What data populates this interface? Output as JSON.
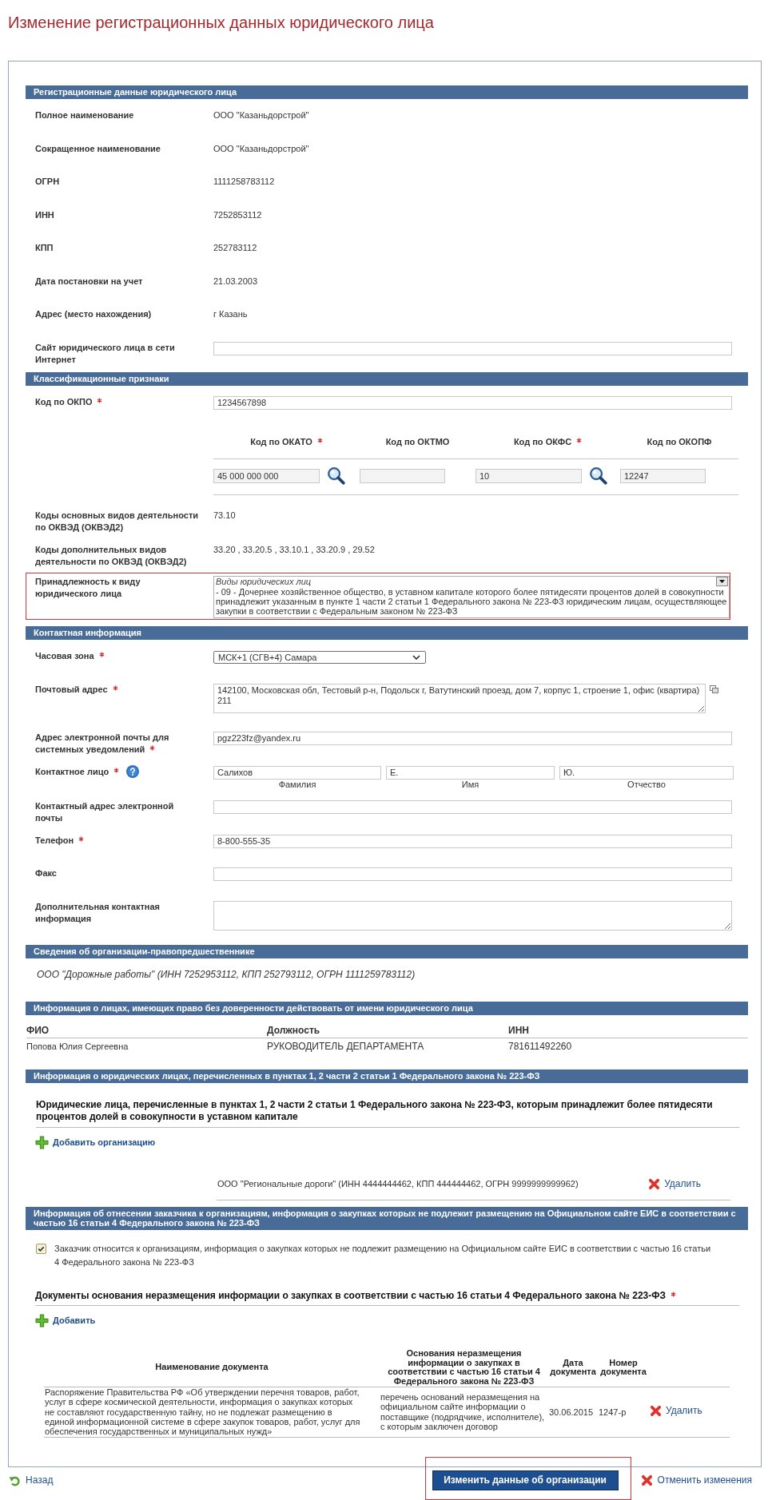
{
  "page_title": "Изменение регистрационных данных юридического лица",
  "registration": {
    "header": "Регистрационные данные юридического лица",
    "fields": [
      {
        "kind": "text",
        "label": "Полное наименование",
        "value": "ООО \"Казаньдорстрой\""
      },
      {
        "kind": "text",
        "label": "Сокращенное наименование",
        "value": "ООО \"Казаньдорстрой\""
      },
      {
        "kind": "text",
        "label": "ОГРН",
        "value": "1111258783112"
      },
      {
        "kind": "text",
        "label": "ИНН",
        "value": "7252853112"
      },
      {
        "kind": "text",
        "label": "КПП",
        "value": "252783112"
      },
      {
        "kind": "text",
        "label": "Дата постановки на учет",
        "value": "21.03.2003"
      },
      {
        "kind": "text",
        "label": "Адрес (место нахождения)",
        "value": "г Казань"
      },
      {
        "kind": "input",
        "label": "Сайт юридического лица в сети Интернет"
      }
    ]
  },
  "classification": {
    "header": "Классификационные признаки",
    "okpo": {
      "label": "Код по ОКПО",
      "required": true,
      "value": "1234567898"
    },
    "codes": [
      {
        "label": "Код по ОКАТО",
        "required": true,
        "value": "45 000 000 000",
        "lookup": true,
        "disabled": true
      },
      {
        "label": "Код по ОКТМО",
        "required": false,
        "lookup": false,
        "disabled": true
      },
      {
        "label": "Код по ОКФС",
        "required": true,
        "value": "10",
        "lookup": true,
        "disabled": true
      },
      {
        "label": "Код по ОКОПФ",
        "required": false,
        "value": "12247",
        "lookup": false,
        "disabled": true
      }
    ],
    "activities": [
      {
        "label": "Коды основных видов деятельности по ОКВЭД (ОКВЭД2)",
        "value": "73.10"
      },
      {
        "label": "Коды дополнительных видов деятельности по ОКВЭД (ОКВЭД2)",
        "value": "33.20 , 33.20.5 , 33.10.1 , 33.20.9 , 29.52"
      }
    ],
    "entity_type": {
      "label": "Принадлежность к виду юридического лица",
      "highlighted": true,
      "hint": "Виды юридических лиц",
      "value": "- 09 - Дочернее хозяйственное общество, в уставном капитале которого более пятидесяти процентов долей в совокупности принадлежит указанным в пункте 1 части 2 статьи 1 Федерального закона № 223-ФЗ юридическим лицам, осуществляющее закупки в соответствии с Федеральным законом № 223-ФЗ"
    }
  },
  "contact": {
    "header": "Контактная информация",
    "fields": [
      {
        "kind": "select",
        "label": "Часовая зона",
        "required": true,
        "value": "МСК+1 (СГВ+4) Самара"
      },
      {
        "kind": "textarea",
        "label": "Почтовый адрес",
        "required": true,
        "value": "142100, Московская обл, Тестовый р-н, Подольск г, Ватутинский проезд, дом 7, корпус 1, строение 1, офис (квартира) 211",
        "copy_button": true
      },
      {
        "kind": "input",
        "label": "Адрес электронной почты для системных уведомлений",
        "required": true,
        "value": "pgz223fz@yandex.ru"
      },
      {
        "kind": "person",
        "label": "Контактное лицо",
        "required": true,
        "help": true,
        "parts": [
          {
            "value": "Салихов",
            "caption": "Фамилия"
          },
          {
            "value": "Е.",
            "caption": "Имя"
          },
          {
            "value": "Ю.",
            "caption": "Отчество"
          }
        ]
      },
      {
        "kind": "input",
        "label": "Контактный адрес электронной почты",
        "required": false
      },
      {
        "kind": "input",
        "label": "Телефон",
        "required": true,
        "value": "8-800-555-35"
      },
      {
        "kind": "input",
        "label": "Факс",
        "required": false
      },
      {
        "kind": "textarea",
        "label": "Дополнительная контактная информация",
        "required": false,
        "copy_button": false
      }
    ]
  },
  "predecessor": {
    "header": "Сведения об организации-правопредшественнике",
    "text": "ООО \"Дорожные работы\" (ИНН 7252953112, КПП 252793112, ОГРН 1111259783112)"
  },
  "authorized_persons": {
    "header": "Информация о лицах, имеющих право без доверенности действовать от имени юридического лица",
    "columns": [
      "ФИО",
      "Должность",
      "ИНН"
    ],
    "rows": [
      [
        "Попова Юлия Сергеевна",
        "РУКОВОДИТЕЛЬ ДЕПАРТАМЕНТА",
        "781611492260"
      ]
    ]
  },
  "owners": {
    "header": "Информация о юридических лицах, перечисленных в пунктах 1, 2 части 2 статьи 1 Федерального закона № 223-ФЗ",
    "subtitle": "Юридические лица, перечисленные в пунктах 1, 2 части 2 статьи 1 Федерального закона № 223-ФЗ, которым принадлежит более пятидесяти процентов долей в совокупности в уставном капитале",
    "add_link": "Добавить организацию",
    "items": [
      {
        "text": "ООО \"Региональные дороги\" (ИНН 4444444462, КПП 444444462, ОГРН 9999999999962)",
        "delete_link": "Удалить"
      }
    ]
  },
  "nondisclosure": {
    "header": "Информация об отнесении заказчика к организациям, информация о закупках которых не подлежит размещению на Официальном сайте ЕИС в соответствии с частью 16 статьи 4 Федерального закона № 223-ФЗ",
    "checkbox": {
      "checked": true,
      "label": "Заказчик относится к организациям, информация о закупках которых не подлежит размещению на Официальном сайте ЕИС в соответствии с частью 16 статьи 4 Федерального закона № 223-ФЗ"
    },
    "documents_title": "Документы основания неразмещения информации о закупках в соответствии с частью 16 статьи 4 Федерального закона № 223-ФЗ",
    "documents_required": true,
    "add_link": "Добавить",
    "table": {
      "columns": [
        "Наименование документа",
        "Основания неразмещения информации о закупках в соответствии с частью 16 статьи 4 Федерального закона № 223-ФЗ",
        "Дата документа",
        "Номер документа"
      ],
      "rows": [
        {
          "cells": [
            "Распоряжение Правительства РФ «Об утверждении перечня товаров, работ, услуг в сфере космической деятельности, информация о закупках которых не составляют государственную тайну, но не подлежат размещению в единой информационной системе в сфере закупок товаров, работ, услуг для обеспечения государственных и муниципальных нужд»",
            "перечень оснований неразмещения на официальном сайте информации о поставщике (подрядчике, исполнителе), с которым заключен договор",
            "30.06.2015",
            "1247-р"
          ],
          "delete_link": "Удалить"
        }
      ]
    }
  },
  "footer": {
    "back_link": "Назад",
    "submit_button": "Изменить данные об организации",
    "submit_highlighted": true,
    "cancel_link": "Отменить изменения"
  }
}
